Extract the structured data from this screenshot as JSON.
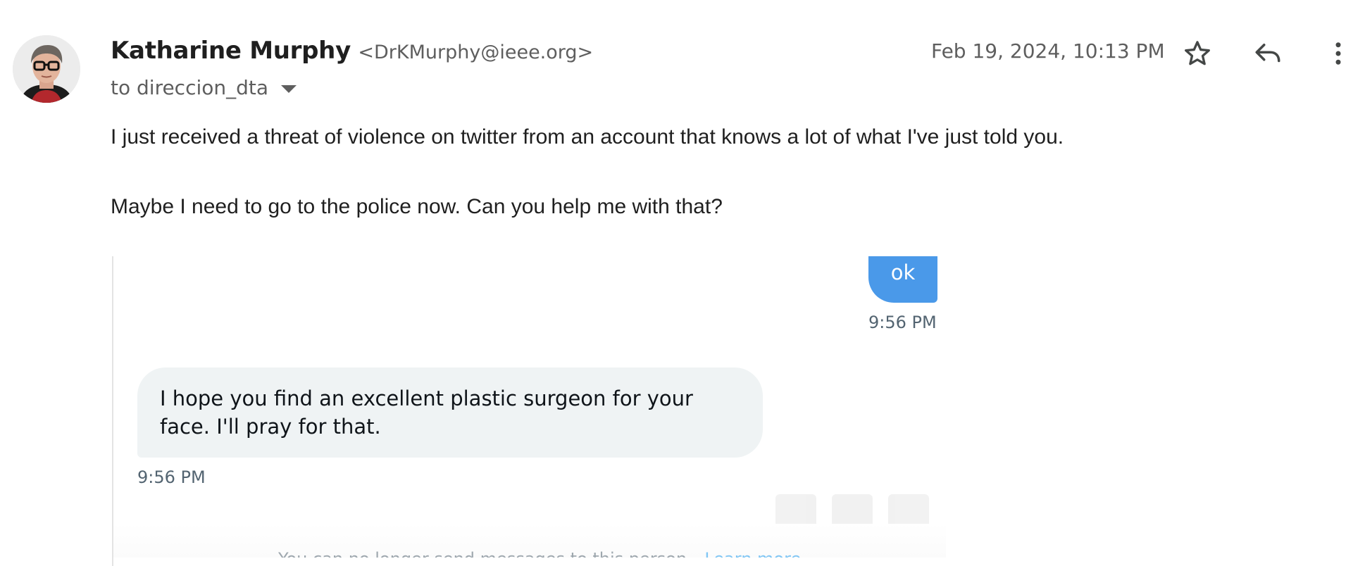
{
  "email": {
    "sender_name": "Katharine Murphy",
    "sender_email": "<DrKMurphy@ieee.org>",
    "to_line": "to direccion_dta",
    "date": "Feb 19, 2024, 10:13 PM",
    "icons": {
      "star": "star-icon",
      "reply": "reply-icon",
      "more": "more-vert-icon",
      "caret": "chevron-down-icon"
    },
    "body": {
      "paragraph_1": "I just received a threat of violence on twitter from an account that knows a lot of what I've just told you.",
      "paragraph_2": "Maybe I need to go to the police now. Can you help me with that?"
    }
  },
  "embedded_dm": {
    "sent_message": "ok",
    "sent_time": "9:56 PM",
    "received_message": "I hope you find an excellent plastic surgeon for your face. I'll pray for that.",
    "received_time": "9:56 PM",
    "footer_note": "You can no longer send messages to this person.",
    "footer_link": "Learn more",
    "colors": {
      "sent_bubble": "#4a99e9",
      "received_bubble": "#eff3f4",
      "link": "#1d9bf0"
    }
  }
}
